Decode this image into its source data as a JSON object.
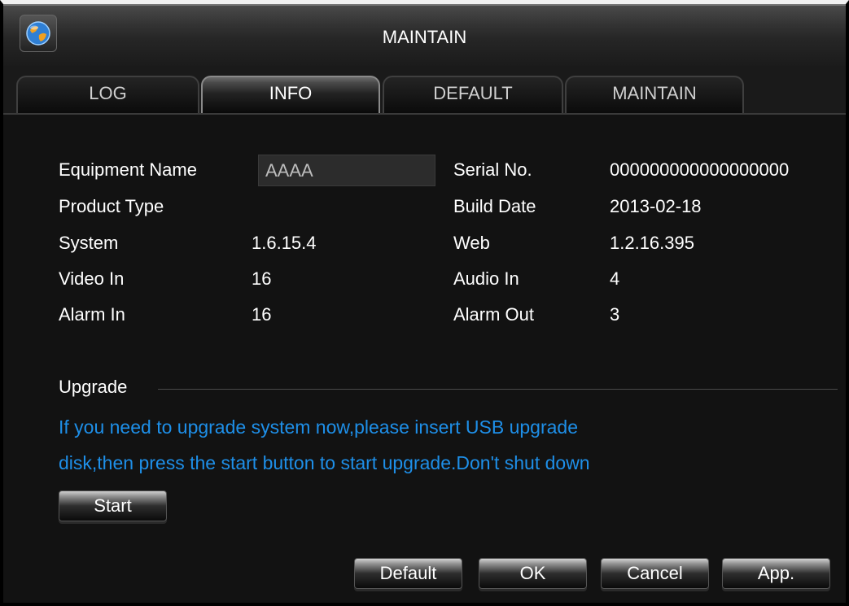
{
  "window": {
    "title": "MAINTAIN"
  },
  "tabs": [
    {
      "label": "LOG"
    },
    {
      "label": "INFO"
    },
    {
      "label": "DEFAULT"
    },
    {
      "label": "MAINTAIN"
    }
  ],
  "info": {
    "equipment_name_label": "Equipment Name",
    "equipment_name_value": "AAAA",
    "product_type_label": "Product Type",
    "product_type_value": "",
    "system_label": "System",
    "system_value": "1.6.15.4",
    "video_in_label": "Video In",
    "video_in_value": "16",
    "alarm_in_label": "Alarm In",
    "alarm_in_value": "16",
    "serial_label": "Serial No.",
    "serial_value": "000000000000000000",
    "build_date_label": "Build Date",
    "build_date_value": "2013-02-18",
    "web_label": "Web",
    "web_value": "1.2.16.395",
    "audio_in_label": "Audio In",
    "audio_in_value": "4",
    "alarm_out_label": "Alarm Out",
    "alarm_out_value": "3"
  },
  "upgrade": {
    "title": "Upgrade",
    "message_line1": "If you need to upgrade system now,please insert USB upgrade",
    "message_line2": "disk,then press the start button to start upgrade.Don't shut down",
    "start_label": "Start"
  },
  "footer": {
    "default_label": "Default",
    "ok_label": "OK",
    "cancel_label": "Cancel",
    "apply_label": "App."
  },
  "colors": {
    "info_text": "#1e8fe8",
    "background": "#121212"
  },
  "icons": {
    "title_icon": "globe-icon"
  }
}
